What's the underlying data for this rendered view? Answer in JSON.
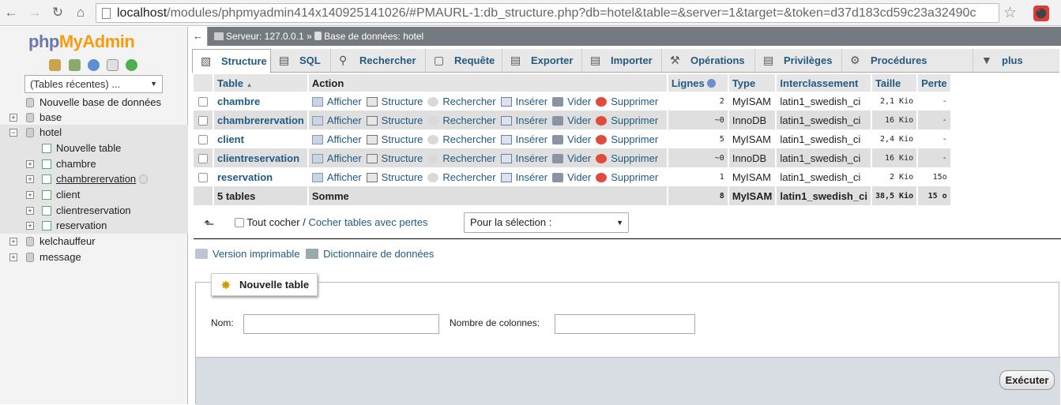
{
  "browser": {
    "url_host": "localhost",
    "url_path": "/modules/phpmyadmin414x140925141026/#PMAURL-1:db_structure.php?db=hotel&table=&server=1&target=&token=d37d183cd59c23a32490c"
  },
  "sidebar": {
    "logo_php": "php",
    "logo_myadmin": "MyAdmin",
    "recent_tables": "(Tables récentes) ...",
    "new_database": "Nouvelle base de données",
    "databases": [
      "base",
      "hotel",
      "kelchauffeur",
      "message"
    ],
    "hotel_children": {
      "new_table": "Nouvelle table",
      "tables": [
        "chambre",
        "chambrerervation",
        "client",
        "clientreservation",
        "reservation"
      ]
    }
  },
  "breadcrumb": {
    "server": "Serveur: 127.0.0.1",
    "sep": "»",
    "database": "Base de données: hotel"
  },
  "tabs": [
    "Structure",
    "SQL",
    "Rechercher",
    "Requête",
    "Exporter",
    "Importer",
    "Opérations",
    "Privilèges",
    "Procédures stockées",
    "plus"
  ],
  "table": {
    "headers": {
      "table": "Table",
      "action": "Action",
      "rows": "Lignes",
      "type": "Type",
      "collation": "Interclassement",
      "size": "Taille",
      "overhead": "Perte"
    },
    "actions": [
      "Afficher",
      "Structure",
      "Rechercher",
      "Insérer",
      "Vider",
      "Supprimer"
    ],
    "rows": [
      {
        "name": "chambre",
        "rows": "2",
        "type": "MyISAM",
        "collation": "latin1_swedish_ci",
        "size": "2,1 Kio",
        "overhead": "-"
      },
      {
        "name": "chambrerervation",
        "rows": "~0",
        "type": "InnoDB",
        "collation": "latin1_swedish_ci",
        "size": "16 Kio",
        "overhead": "-"
      },
      {
        "name": "client",
        "rows": "5",
        "type": "MyISAM",
        "collation": "latin1_swedish_ci",
        "size": "2,4 Kio",
        "overhead": "-"
      },
      {
        "name": "clientreservation",
        "rows": "~0",
        "type": "InnoDB",
        "collation": "latin1_swedish_ci",
        "size": "16 Kio",
        "overhead": "-"
      },
      {
        "name": "reservation",
        "rows": "1",
        "type": "MyISAM",
        "collation": "latin1_swedish_ci",
        "size": "2 Kio",
        "overhead": "15o"
      }
    ],
    "footer": {
      "count": "5 tables",
      "label": "Somme",
      "rows": "8",
      "type": "MyISAM",
      "collation": "latin1_swedish_ci",
      "size": "38,5 Kio",
      "overhead": "15 o"
    }
  },
  "bulk": {
    "check_all": "Tout cocher",
    "separator": "/",
    "check_overhead": "Cocher tables avec pertes",
    "with_selected": "Pour la sélection :"
  },
  "links": {
    "print": "Version imprimable",
    "dictionary": "Dictionnaire de données"
  },
  "new_table": {
    "legend": "Nouvelle table",
    "name_label": "Nom:",
    "cols_label": "Nombre de colonnes:",
    "submit": "Exécuter"
  },
  "colors": {
    "link": "#235a81",
    "breadcrumb_bg": "#747a80",
    "row_alt": "#dfdfdf"
  }
}
